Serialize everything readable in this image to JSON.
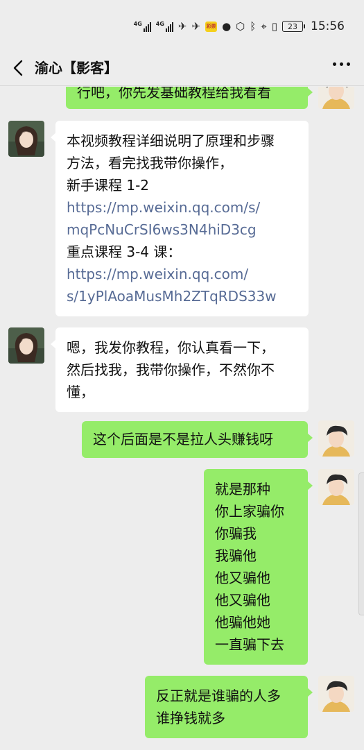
{
  "status_bar": {
    "network_1": "4G",
    "network_2": "4G",
    "badge": "彩票",
    "battery": "23",
    "time": "15:56"
  },
  "header": {
    "back_icon": "chevron-left-icon",
    "title": "渝心【影客】",
    "more_icon": "more-dots-icon"
  },
  "messages": [
    {
      "side": "right",
      "lines": [
        "行吧，你先发基础教程给我看看"
      ]
    },
    {
      "side": "left",
      "lines": [
        "本视频教程详细说明了原理和步骤",
        "方法，看完找我带你操作，",
        "新手课程 1-2",
        "https://mp.weixin.qq.com/s/",
        "mqPcNuCrSI6ws3N4hiD3cg",
        "重点课程 3-4 课：",
        "https://mp.weixin.qq.com/",
        "s/1yPlAoaMusMh2ZTqRDS33w"
      ]
    },
    {
      "side": "left",
      "lines": [
        "嗯，我发你教程，你认真看一下，",
        "然后找我，我带你操作，不然你不",
        "懂，"
      ]
    },
    {
      "side": "right",
      "lines": [
        "这个后面是不是拉人头赚钱呀"
      ]
    },
    {
      "side": "right",
      "lines": [
        "就是那种",
        "你上家骗你",
        "你骗我",
        "我骗他",
        "他又骗他",
        "他又骗他",
        "他骗他她",
        "一直骗下去"
      ]
    },
    {
      "side": "right",
      "lines": [
        "反正就是谁骗的人多",
        "谁挣钱就多"
      ]
    }
  ],
  "colors": {
    "background": "#ededed",
    "bubble_right": "#95ec69",
    "bubble_left": "#ffffff",
    "link": "#576b95"
  }
}
